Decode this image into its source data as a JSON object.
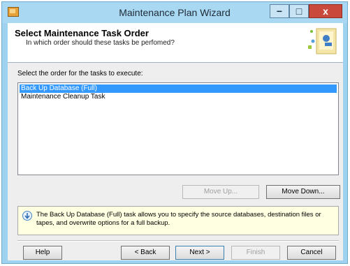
{
  "window": {
    "title": "Maintenance Plan Wizard",
    "controls": {
      "minimize": "−",
      "maximize": "□",
      "close": "x"
    }
  },
  "header": {
    "title": "Select Maintenance Task Order",
    "subtitle": "In which order should these tasks be perfomed?"
  },
  "main": {
    "select_label": "Select the order for the tasks to execute:",
    "tasks": [
      {
        "label": "Back Up Database (Full)",
        "selected": true
      },
      {
        "label": "Maintenance Cleanup Task",
        "selected": false
      }
    ],
    "move_up_label": "Move Up...",
    "move_down_label": "Move Down...",
    "info_text": "The Back Up Database (Full) task allows you to specify the source databases, destination files or tapes, and overwrite options for a full backup."
  },
  "footer": {
    "help_label": "Help",
    "back_label": "< Back",
    "next_label": "Next >",
    "finish_label": "Finish",
    "cancel_label": "Cancel"
  },
  "colors": {
    "titlebar": "#a9d8f2",
    "selection": "#3399ff",
    "info_background": "#ffffe1",
    "close_button": "#c94a3d"
  },
  "icons": {
    "app": "maintenance-plan-icon",
    "wizard": "wizard-graphic-icon",
    "info": "info-arrow-icon"
  }
}
